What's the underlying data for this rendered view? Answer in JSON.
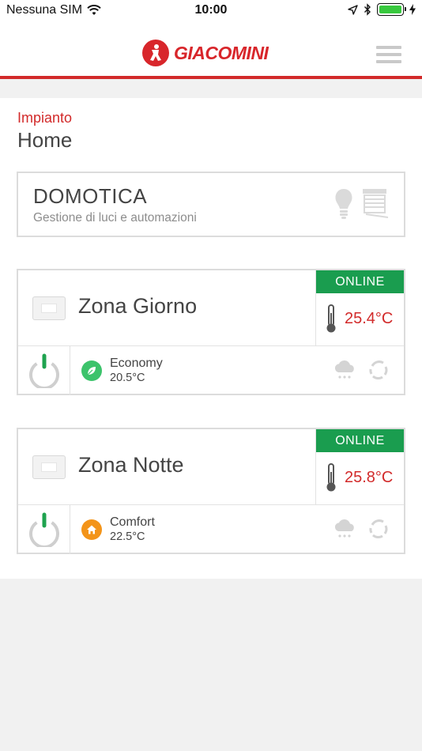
{
  "status_bar": {
    "carrier": "Nessuna SIM",
    "time": "10:00"
  },
  "header": {
    "logo_text": "GIACOMINI"
  },
  "plant": {
    "label": "Impianto",
    "name": "Home"
  },
  "domotica": {
    "title": "DOMOTICA",
    "subtitle": "Gestione di luci e automazioni"
  },
  "zones": [
    {
      "name": "Zona Giorno",
      "status": "ONLINE",
      "temperature": "25.4°C",
      "mode": "Economy",
      "setpoint": "20.5°C",
      "mode_color": "#3cc36b"
    },
    {
      "name": "Zona Notte",
      "status": "ONLINE",
      "temperature": "25.8°C",
      "mode": "Comfort",
      "setpoint": "22.5°C",
      "mode_color": "#f39419"
    }
  ],
  "colors": {
    "accent": "#d22a2a",
    "online": "#1a9d4f",
    "battery": "#38c83e"
  }
}
